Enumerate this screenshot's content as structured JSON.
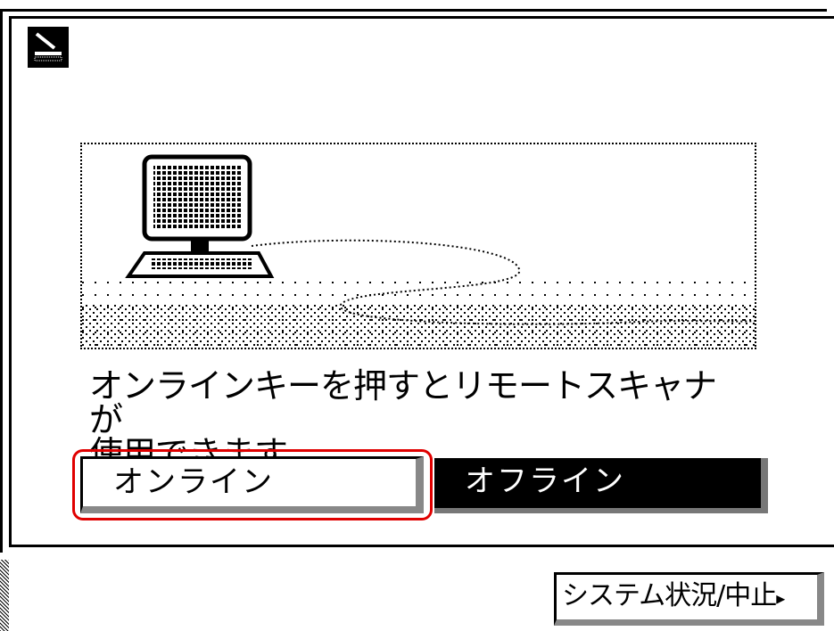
{
  "icons": {
    "mode_icon": "scanner-icon",
    "computer": "computer-icon",
    "arrow": "triangle-right-icon"
  },
  "message": {
    "line1": "オンラインキーを押すとリモートスキャナが",
    "line2": "使用できます。"
  },
  "buttons": {
    "online_label": "オンライン",
    "offline_label": "オフライン",
    "status_label": "システム状況/中止",
    "status_arrow": "▸"
  },
  "colors": {
    "highlight": "#e00000",
    "active_bg": "#000000",
    "active_fg": "#ffffff"
  }
}
